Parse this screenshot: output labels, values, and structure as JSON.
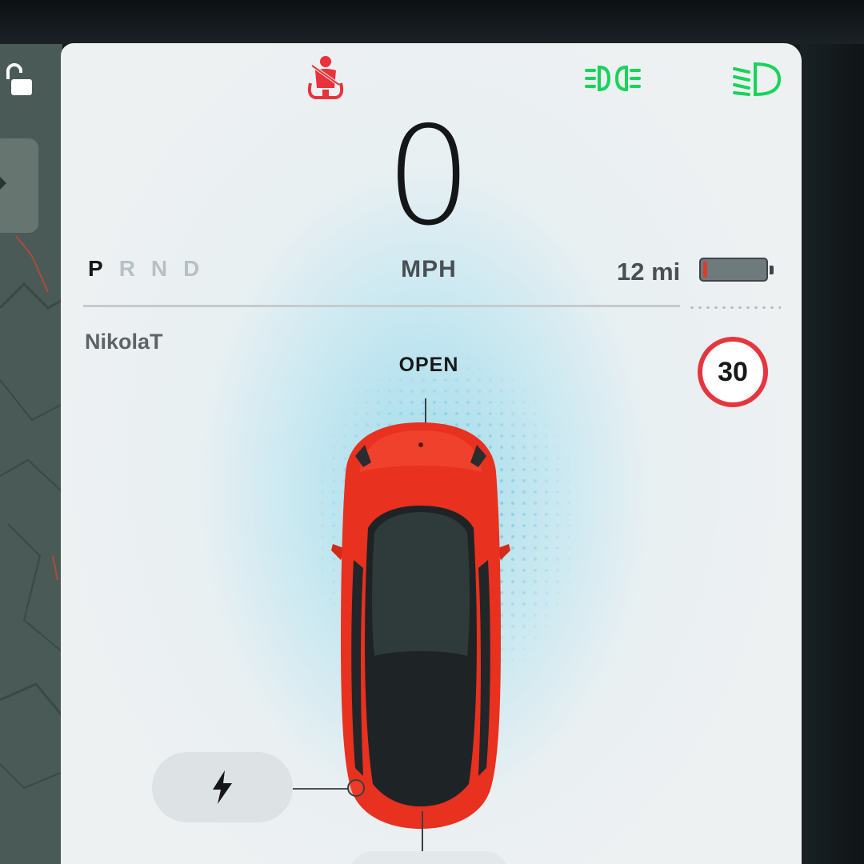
{
  "status_icons": {
    "seatbelt": {
      "icon": "seatbelt-warning-icon",
      "color": "#e8323c"
    },
    "drl": {
      "icon": "daytime-running-lights-icon",
      "color": "#17d45a"
    },
    "low_beam": {
      "icon": "low-beam-headlights-icon",
      "color": "#17d45a"
    }
  },
  "speed": {
    "value": "0",
    "unit": "MPH"
  },
  "gears": {
    "items": [
      "P",
      "R",
      "N",
      "D"
    ],
    "selected": "P"
  },
  "battery": {
    "range": "12 mi",
    "level": 0.06,
    "low_color": "#e03a2f"
  },
  "driver_profile": "NikolaT",
  "speed_limit": {
    "value": "30",
    "ring_color": "#e5353f"
  },
  "vehicle": {
    "frunk_status": "OPEN",
    "color": "#e8311f"
  },
  "charge_button": {
    "icon": "lightning-bolt-icon"
  },
  "sidebar": {
    "lock_icon": "unlocked-padlock-icon",
    "nav_icon": "chevron-right-icon"
  }
}
